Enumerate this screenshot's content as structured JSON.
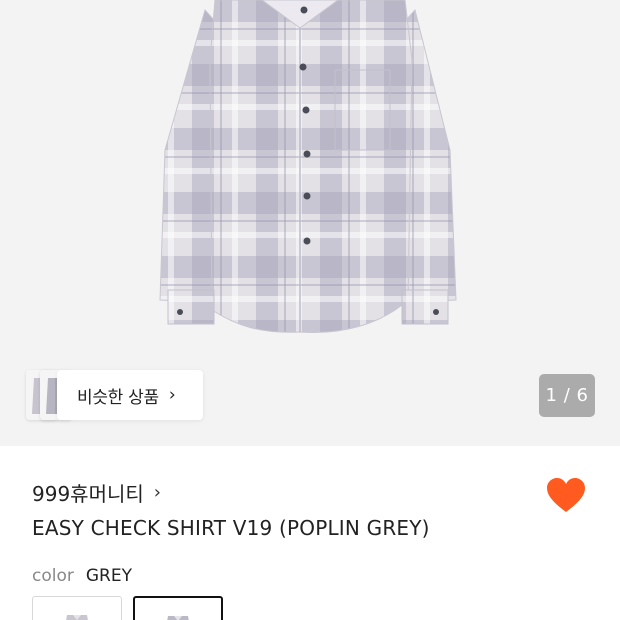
{
  "gallery": {
    "similar_label": "비슷한 상품",
    "similar_chevron": "›",
    "page_indicator": "1 / 6"
  },
  "product": {
    "brand": "999휴머니티",
    "brand_chevron": "›",
    "title": "EASY CHECK SHIRT V19 (POPLIN GREY)",
    "favorited": true,
    "heart_color": "#ff5a1f"
  },
  "color_option": {
    "label": "color",
    "value": "GREY",
    "swatches": [
      "grey-check",
      "grey-check-selected"
    ]
  },
  "colors": {
    "shirt_base": "#d6d3dc",
    "shirt_check": "#a9a6bd"
  }
}
